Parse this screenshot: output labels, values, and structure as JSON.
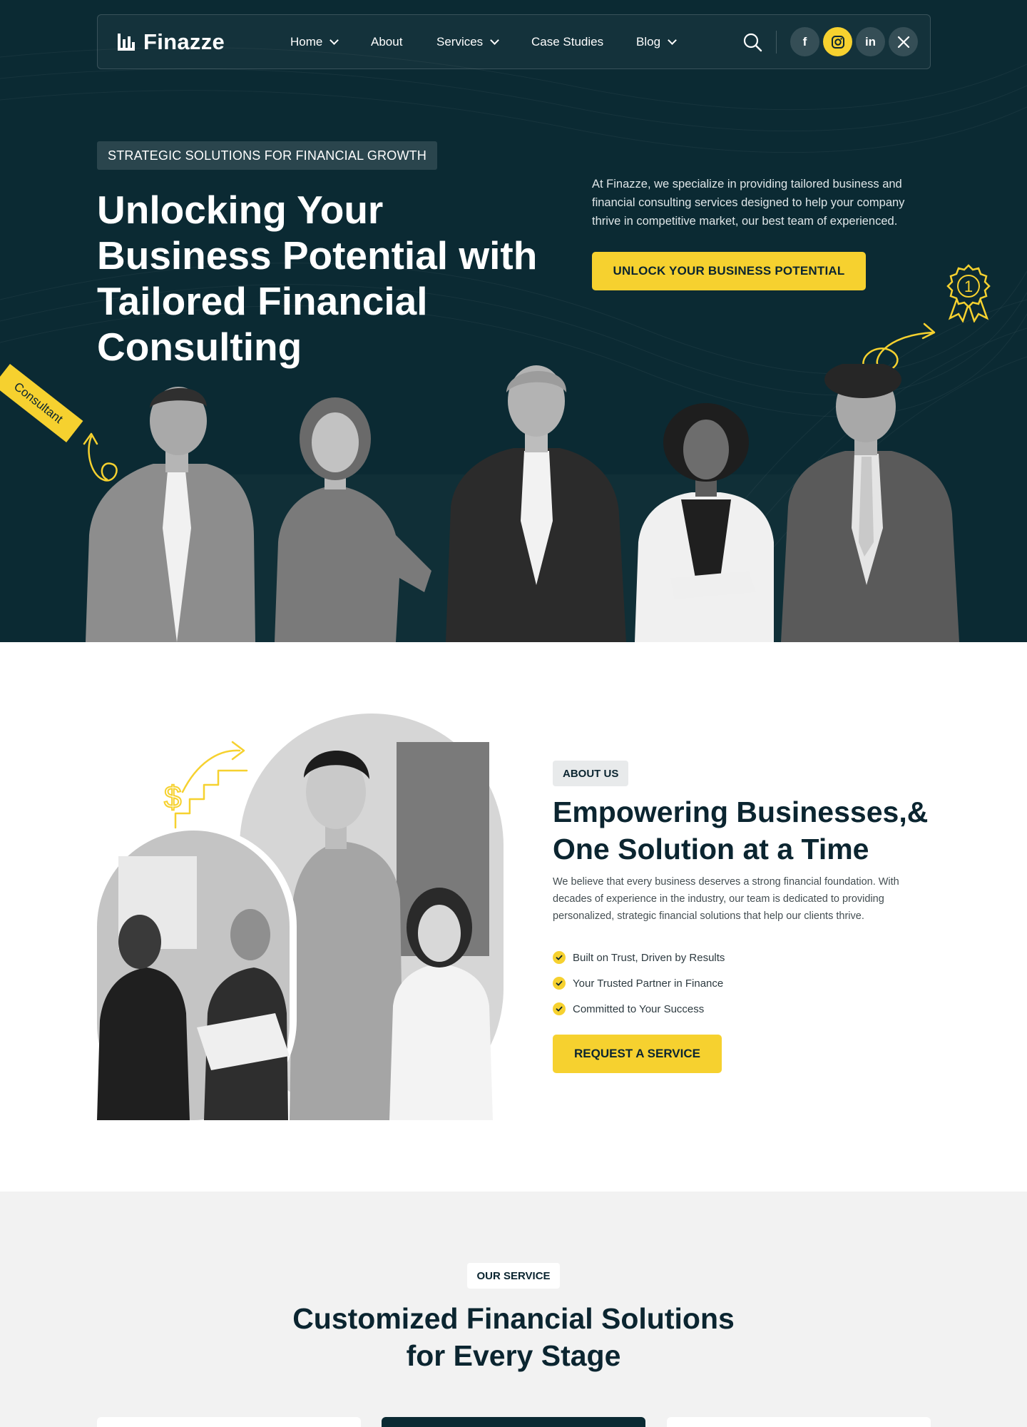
{
  "brand": {
    "name": "Finazze",
    "accent": "#f6d12f",
    "dark": "#0b2a33"
  },
  "nav": {
    "items": [
      {
        "label": "Home",
        "has_dropdown": true
      },
      {
        "label": "About",
        "has_dropdown": false
      },
      {
        "label": "Services",
        "has_dropdown": true
      },
      {
        "label": "Case Studies",
        "has_dropdown": false
      },
      {
        "label": "Blog",
        "has_dropdown": true
      }
    ],
    "search_icon": "search-icon",
    "socials": [
      {
        "icon": "facebook-icon",
        "glyph": "f"
      },
      {
        "icon": "instagram-icon",
        "glyph": "◎",
        "active": true
      },
      {
        "icon": "linkedin-icon",
        "glyph": "in"
      },
      {
        "icon": "x-twitter-icon",
        "glyph": "𝕏"
      }
    ]
  },
  "hero": {
    "tag": "STRATEGIC SOLUTIONS FOR FINANCIAL GROWTH",
    "title": "Unlocking Your Business Potential with Tailored Financial Consulting",
    "description": "At Finazze, we specialize in providing tailored business and financial consulting services designed to help your company thrive in competitive market, our best team of experienced.",
    "cta": "UNLOCK YOUR BUSINESS POTENTIAL",
    "badge_number": "1",
    "consultant_label": "Consultant"
  },
  "about": {
    "tag": "ABOUT US",
    "title": "Empowering Businesses,& One Solution at a Time",
    "description": "We believe that every business deserves a strong financial foundation. With decades of experience in the industry, our team is dedicated to providing personalized, strategic financial solutions that help our clients thrive.",
    "points": [
      "Built on Trust, Driven by Results",
      "Your Trusted Partner in Finance",
      "Committed to Your Success"
    ],
    "cta": "REQUEST A SERVICE",
    "art_symbol": "$"
  },
  "service": {
    "tag": "OUR SERVICE",
    "title_line1": "Customized Financial Solutions",
    "title_line2": "for Every Stage"
  }
}
